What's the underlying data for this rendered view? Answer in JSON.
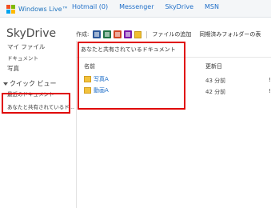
{
  "topbar": {
    "brand": "Windows Live™",
    "nav": [
      "Hotmail (0)",
      "Messenger",
      "SkyDrive",
      "MSN"
    ]
  },
  "sidebar": {
    "title": "SkyDrive",
    "links": [
      "マイ ファイル",
      "ドキュメント",
      "写真"
    ],
    "quick_view": "クイック ビュー",
    "quick_items": [
      "最近のドキュメント",
      "あなたと共有されているド..."
    ]
  },
  "toolbar": {
    "create_label": "作成:",
    "icons": [
      "word-icon",
      "excel-icon",
      "powerpoint-icon",
      "onenote-icon",
      "folder-icon"
    ],
    "add_files": "ファイルの追加",
    "sync_folders": "同期済みフォルダーの表"
  },
  "main": {
    "header": "あなたと共有されているドキュメント",
    "columns": {
      "name": "名前",
      "modified": "更新日"
    },
    "rows": [
      {
        "name": "写真A",
        "modified": "43 分前",
        "extra": "!"
      },
      {
        "name": "動画A",
        "modified": "42 分前",
        "extra": "!"
      }
    ]
  },
  "colors": {
    "highlight": "#e00000",
    "link": "#1e6ec8",
    "folder": "#f2c23c"
  }
}
